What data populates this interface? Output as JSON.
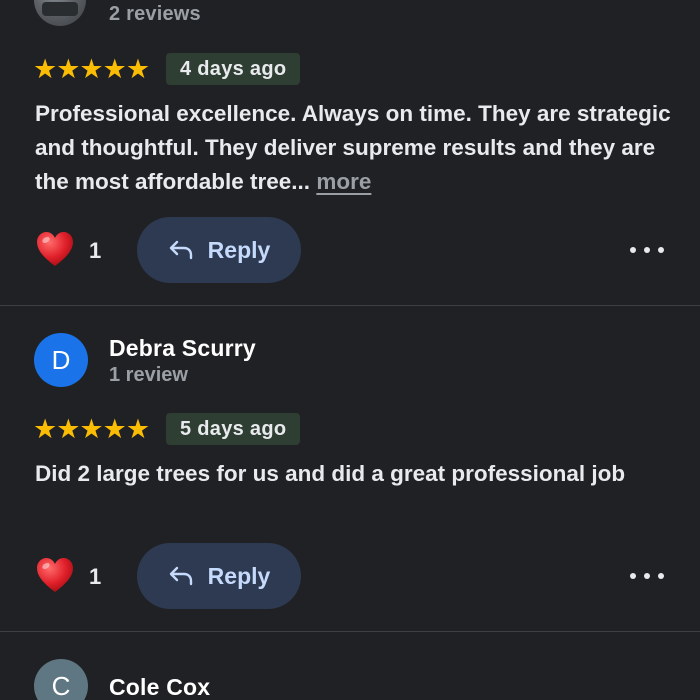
{
  "colors": {
    "background": "#202124",
    "star": "#fbbc04",
    "badge_bg": "#2f3e33",
    "reply_bg": "#2d3a52",
    "reply_text": "#c6dafc",
    "avatar_debra": "#1a73e8",
    "avatar_cole": "#5f7782"
  },
  "reviews": [
    {
      "avatar_icon": "profile-photo",
      "review_count": "2 reviews",
      "stars": "★★★★★",
      "time_ago": "4 days ago",
      "text": "Professional excellence.  Always on time. They are strategic and thoughtful.  They deliver supreme results and they are the most affordable tree...",
      "more_label": "more",
      "likes": "1",
      "reply_label": "Reply"
    },
    {
      "avatar_letter": "D",
      "name": "Debra Scurry",
      "review_count": "1 review",
      "stars": "★★★★★",
      "time_ago": "5 days ago",
      "text": "Did 2 large trees for us and did a great professional job",
      "likes": "1",
      "reply_label": "Reply"
    },
    {
      "avatar_letter": "C",
      "name": "Cole Cox"
    }
  ]
}
